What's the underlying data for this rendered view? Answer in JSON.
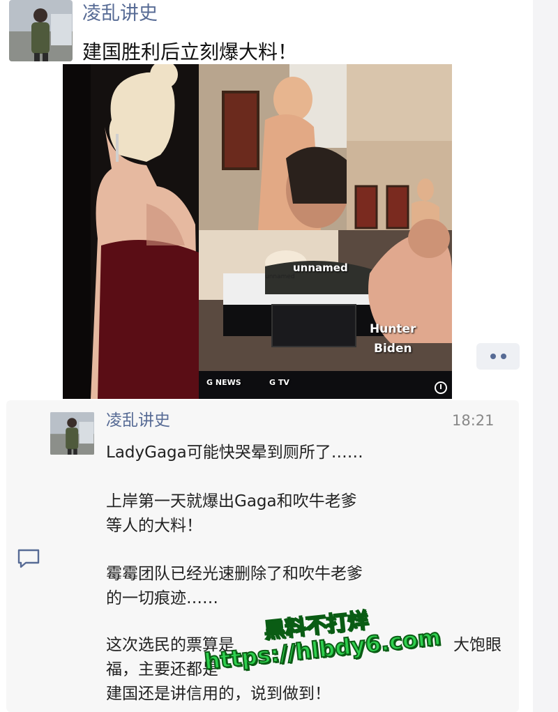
{
  "post": {
    "author": "凌乱讲史",
    "text": "建国胜利后立刻爆大料！"
  },
  "photo": {
    "labels": [
      "unnamed",
      "unnamed",
      "Hunter",
      "Biden"
    ],
    "logos": [
      "G NEWS",
      "G TV"
    ]
  },
  "comment": {
    "author": "凌乱讲史",
    "time": "18:21",
    "lines": [
      "LadyGaga可能快哭晕到厕所了……",
      "上岸第一天就爆出Gaga和吹牛老爹",
      "等人的大料！",
      "霉霉团队已经光速删除了和吹牛老爹",
      "的一切痕迹……",
      "这次选民的票算是",
      "福，主要还都是",
      "建国还是讲信用的，说到做到！"
    ],
    "line_tail": "大饱眼"
  },
  "watermark": {
    "line1": "黑料不打烊",
    "line2": "https://hlbdy6.com"
  },
  "colors": {
    "link_blue": "#576b95",
    "watermark_green": "#2ed04e"
  }
}
